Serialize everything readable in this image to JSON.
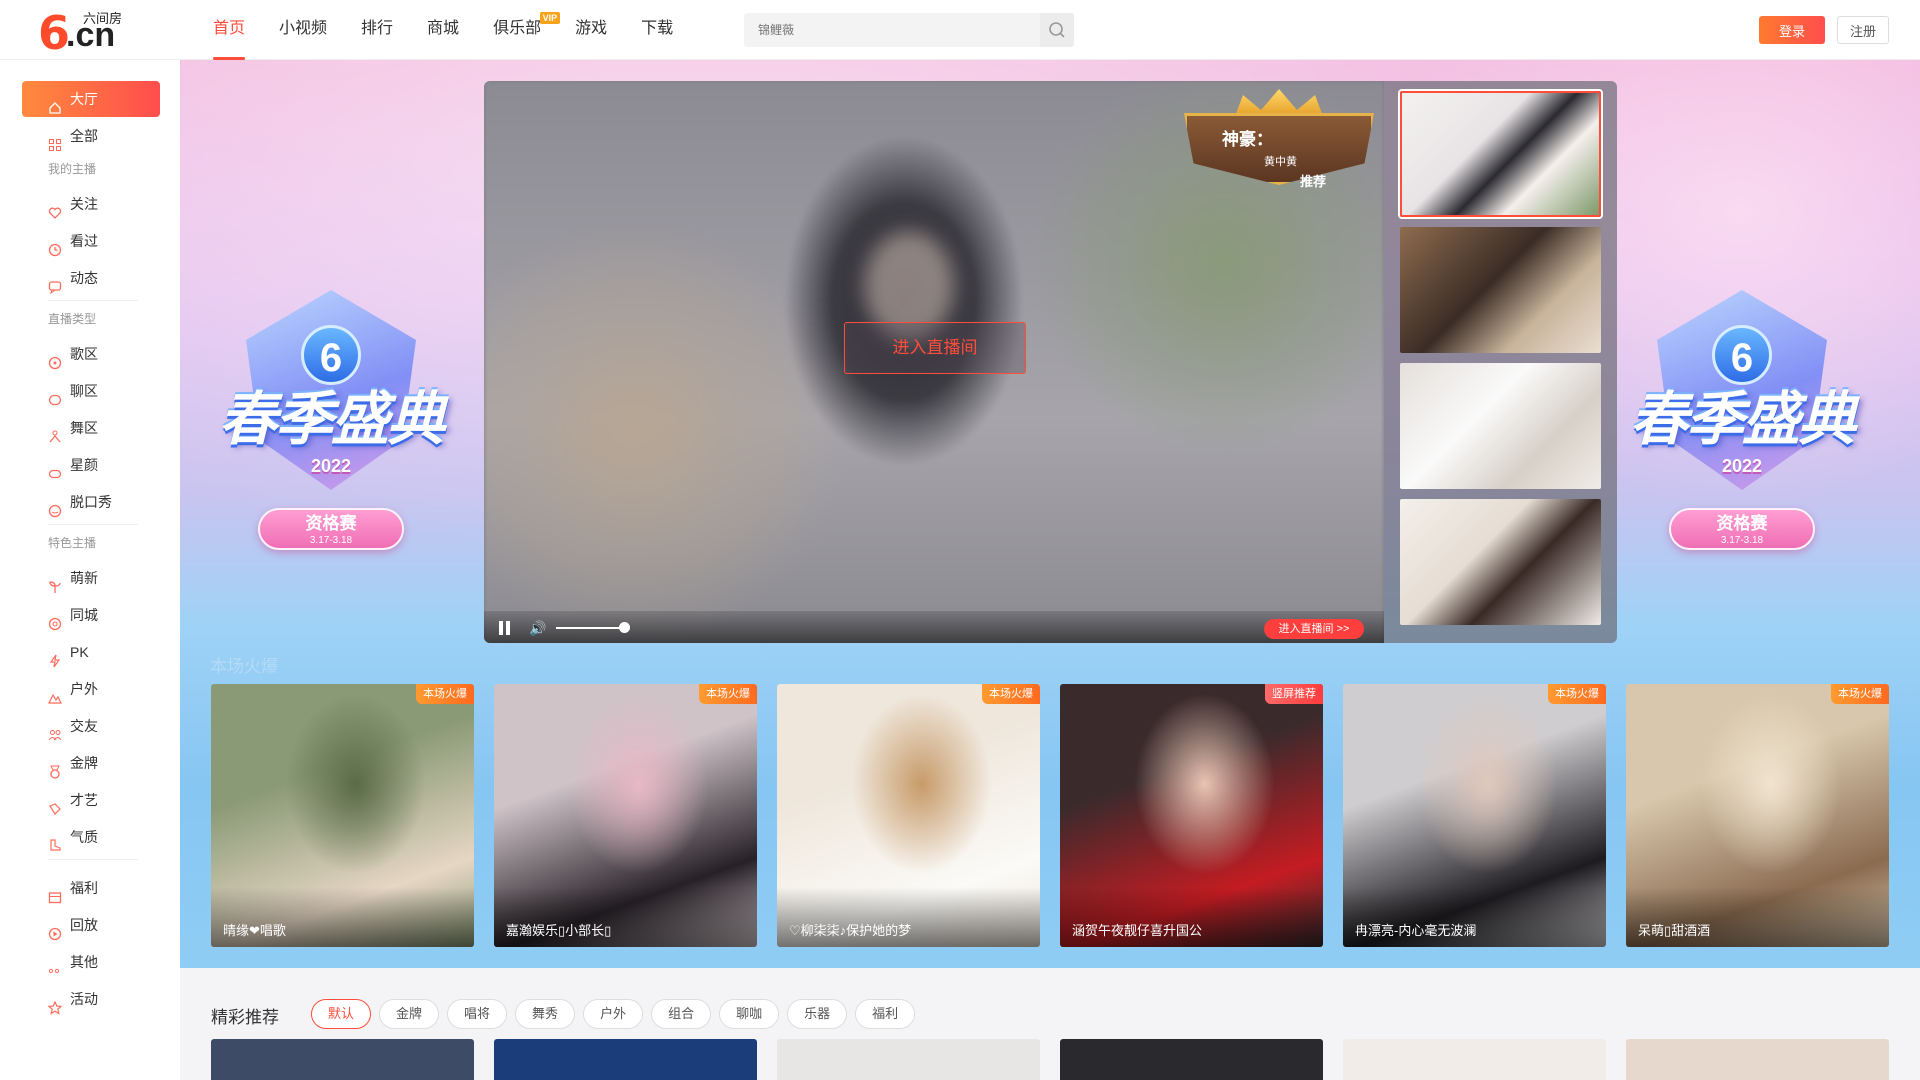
{
  "header": {
    "logo": {
      "text": "六间房",
      "domain": ".cn",
      "mark": "6"
    },
    "nav": [
      {
        "label": "首页",
        "active": true
      },
      {
        "label": "小视频"
      },
      {
        "label": "排行"
      },
      {
        "label": "商城"
      },
      {
        "label": "俱乐部",
        "badge": "VIP"
      },
      {
        "label": "游戏"
      },
      {
        "label": "下载"
      }
    ],
    "search_placeholder": "锦鲤薇",
    "login_label": "登录",
    "register_label": "注册"
  },
  "sidebar": {
    "top_items": [
      {
        "label": "大厅",
        "icon": "home-icon",
        "active": true
      },
      {
        "label": "全部",
        "icon": "grid-icon"
      }
    ],
    "groups": [
      {
        "title": "我的主播",
        "items": [
          {
            "label": "关注",
            "icon": "heart-icon"
          },
          {
            "label": "看过",
            "icon": "clock-icon"
          },
          {
            "label": "动态",
            "icon": "message-icon"
          }
        ]
      },
      {
        "title": "直播类型",
        "items": [
          {
            "label": "歌区",
            "icon": "music-icon"
          },
          {
            "label": "聊区",
            "icon": "chat-icon"
          },
          {
            "label": "舞区",
            "icon": "dance-icon"
          },
          {
            "label": "星颜",
            "icon": "mask-icon"
          },
          {
            "label": "脱口秀",
            "icon": "talk-icon"
          }
        ]
      },
      {
        "title": "特色主播",
        "items": [
          {
            "label": "萌新",
            "icon": "sprout-icon"
          },
          {
            "label": "同城",
            "icon": "location-icon"
          },
          {
            "label": "PK",
            "icon": "lightning-icon"
          },
          {
            "label": "户外",
            "icon": "mountain-icon"
          },
          {
            "label": "交友",
            "icon": "friends-icon"
          },
          {
            "label": "金牌",
            "icon": "medal-icon"
          },
          {
            "label": "才艺",
            "icon": "palette-icon"
          },
          {
            "label": "气质",
            "icon": "boot-icon"
          }
        ]
      }
    ],
    "bottom_items": [
      {
        "label": "福利",
        "icon": "gift-icon"
      },
      {
        "label": "回放",
        "icon": "replay-icon"
      },
      {
        "label": "其他",
        "icon": "more-icon"
      },
      {
        "label": "活动",
        "icon": "star-icon"
      }
    ]
  },
  "banner": {
    "event_title": "春季盛典",
    "event_year": "2022",
    "event_stage": "资格赛",
    "event_dates": "3.17-3.18"
  },
  "player": {
    "enter_label": "进入直播间",
    "enter_small_label": "进入直播间 >>",
    "shenhao_title": "神豪：",
    "shenhao_name": "黄中黄",
    "shenhao_tag": "推荐",
    "volume": 0.9
  },
  "section_title_faded": "本场火爆",
  "hot_cards": [
    {
      "name": "晴缘❤唱歌",
      "tag": "本场火爆",
      "colors": [
        "#8a9a76",
        "#e6d6c4",
        "#5a6b48"
      ]
    },
    {
      "name": "嘉瀚娱乐▯小部长▯",
      "tag": "本场火爆",
      "colors": [
        "#cfc3c8",
        "#272127",
        "#e8b8c6"
      ]
    },
    {
      "name": "♡柳柒柒♪保护她的梦",
      "tag": "本场火爆",
      "colors": [
        "#efe7dc",
        "#fbfaf7",
        "#c79b6a"
      ]
    },
    {
      "name": "涵贺午夜靓仔喜升国公",
      "tag": "竖屏推荐",
      "colors": [
        "#3a2a2c",
        "#c41c22",
        "#e9c4b3"
      ]
    },
    {
      "name": "冉漂亮-内心毫无波澜",
      "tag": "本场火爆",
      "colors": [
        "#cfcdd0",
        "#1d1b1f",
        "#e0c9bd"
      ]
    },
    {
      "name": "呆萌▯甜酒酒",
      "tag": "本场火爆",
      "colors": [
        "#d8c7ac",
        "#8a6b50",
        "#f1e4cf"
      ]
    }
  ],
  "recommend": {
    "title": "精彩推荐",
    "filters": [
      {
        "label": "默认",
        "active": true
      },
      {
        "label": "金牌"
      },
      {
        "label": "唱将"
      },
      {
        "label": "舞秀"
      },
      {
        "label": "户外"
      },
      {
        "label": "组合"
      },
      {
        "label": "聊咖"
      },
      {
        "label": "乐器"
      },
      {
        "label": "福利"
      }
    ],
    "card_colors": [
      "#3e4b66",
      "#1b3e7a",
      "#e8e6e4",
      "#2a2a2e",
      "#f1ece8",
      "#e6d8cc"
    ]
  },
  "colors": {
    "accent": "#ff4c3b",
    "accent_gradient_start": "#ff8a3d"
  }
}
